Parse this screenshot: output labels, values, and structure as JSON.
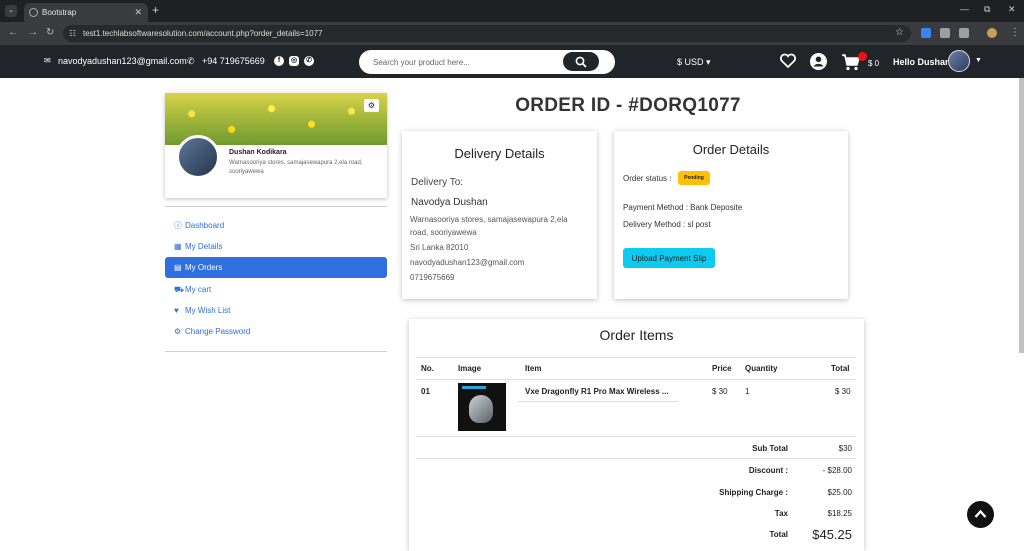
{
  "browser": {
    "tab_title": "Bootstrap",
    "url": "test1.techlabsoftwaresolution.com/account.php?order_details=1077"
  },
  "topbar": {
    "email": "navodyadushan123@gmail.com",
    "phone": "+94 719675669",
    "search_placeholder": "Search your product here...",
    "currency": "$ USD",
    "cart_amount": "$ 0",
    "greeting": "Hello Dushan"
  },
  "profile": {
    "name": "Dushan Kodikara",
    "address": "Warnasooriya stores, samajasewapura 2,ela road, sooriyawewa"
  },
  "sidebar": {
    "items": [
      {
        "label": "Dashboard",
        "icon": "info-circle-icon"
      },
      {
        "label": "My Details",
        "icon": "calendar-icon"
      },
      {
        "label": "My Orders",
        "icon": "book-icon"
      },
      {
        "label": "My cart",
        "icon": "cart-icon"
      },
      {
        "label": "My Wish List",
        "icon": "heart-icon"
      },
      {
        "label": "Change Password",
        "icon": "gear-icon"
      }
    ],
    "active_index": 2
  },
  "order": {
    "title": "ORDER ID - #DORQ1077"
  },
  "delivery": {
    "heading": "Delivery Details",
    "to_label": "Delivery To:",
    "name": "Navodya Dushan",
    "address_line1": "Warnasooriya stores, samajasewapura 2,ela",
    "address_line2": "road, sooriyawewa",
    "country": "Sri Lanka 82010",
    "email": "navodyadushan123@gmail.com",
    "phone": "0719675669"
  },
  "order_details": {
    "heading": "Order Details",
    "status_label": "Order status :",
    "status": "Pending",
    "payment_method": "Payment Method :  Bank Deposite",
    "delivery_method": "Delivery Method :  sl post",
    "upload_button": "Upload Payment Slip"
  },
  "items": {
    "heading": "Order Items",
    "columns": [
      "No.",
      "Image",
      "Item",
      "Price",
      "Quantity",
      "Total"
    ],
    "rows": [
      {
        "no": "01",
        "item": "Vxe Dragonfly R1 Pro Max Wireless ...",
        "price": "$ 30",
        "quantity": "1",
        "total": "$ 30"
      }
    ],
    "summary": {
      "subtotal_label": "Sub Total",
      "subtotal": "$30",
      "discount_label": "Discount :",
      "discount": "- $28.00",
      "shipping_label": "Shipping Charge :",
      "shipping": "$25.00",
      "tax_label": "Tax",
      "tax": "$18.25",
      "total_label": "Total",
      "total": "$45.25"
    }
  },
  "colors": {
    "topbar": "#212529",
    "primary": "#2f6fe0",
    "pending_badge": "#ffc107",
    "upload_button": "#0dcaf0"
  }
}
